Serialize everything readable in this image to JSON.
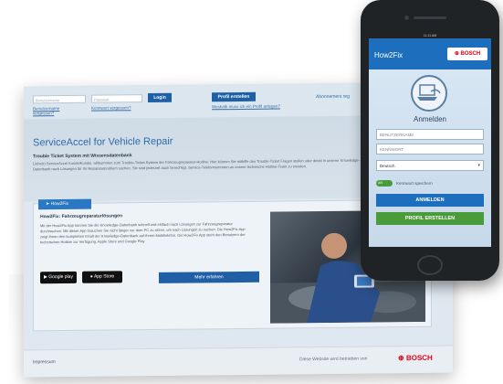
{
  "desktop": {
    "username_placeholder": "Benutzername",
    "password_placeholder": "Passwort",
    "login_label": "Login",
    "forgot_username": "Benutzername vergessen?",
    "forgot_password": "Kennwort vergessen?",
    "create_profile": "Profil erstellen",
    "profile_note": "Weshalb muss ich ein Profil anlegen?",
    "abo": "Abonnement reg",
    "hero_title": "ServiceAccel for Vehicle Repair",
    "hero_subtitle": "Trouble Ticket System mit Wissensdatenbank",
    "hero_text": "Liebe(r) ServiceAccel Kunde/Kundin, willkommen zum Trouble-Ticket-System der Fahrzeugreparatur-Hotline. Hier können Sie mithilfe des Trouble-Ticket Fragen stellen oder direkt in unserer Knowledge-Datenbank nach Lösungen für Ihr Reparaturproblem suchen. Sie sind jederzeit auch berechtigt, Service-Telefonnummern an unsere technische Hotline-Team zu wenden.",
    "tab_label": "How2Fix",
    "panel_title": "How2Fix: Fahrzeugreparaturlösungen",
    "panel_text": "Mit der How2Fix App können Sie die Knowledge-Datenbank schnell und einfach nach Lösungen zur Fahrzeugreparatur durchsuchen. Mit dieser App brauchen Sie nicht länger vor dem PC zu sitzen, um nach Lösungen zu suchen. Die How2Fix App zeigt Ihnen den kompletten Inhalt der Knowledge-Datenbank auf Ihrem Mobiltelefon. Die How2Fix App steht den Benutzern der technischen Hotline zur Verfügung. Apple Store und Google Play",
    "google_play": "Google play",
    "app_store": "App Store",
    "mehr": "Mehr erfahren",
    "impressum": "Impressum",
    "betrieben": "Diese Website wird betrieben von",
    "bosch": "BOSCH"
  },
  "phone": {
    "status": "11:11 AM",
    "app_title": "How2Fix",
    "bosch": "BOSCH",
    "anmelden": "Anmelden",
    "username": "BENUTZERNAME",
    "password": "KENNWORT",
    "language": "Deutsch",
    "toggle": "AN",
    "remember": "Kennwort speichern",
    "login_button": "ANMELDEN",
    "profile_button": "PROFIL ERSTELLEN",
    "colors": {
      "header": "#1d6fbd",
      "login": "#1d6fbd",
      "profile": "#4a9b3a",
      "bosch_red": "#e2001a"
    }
  }
}
